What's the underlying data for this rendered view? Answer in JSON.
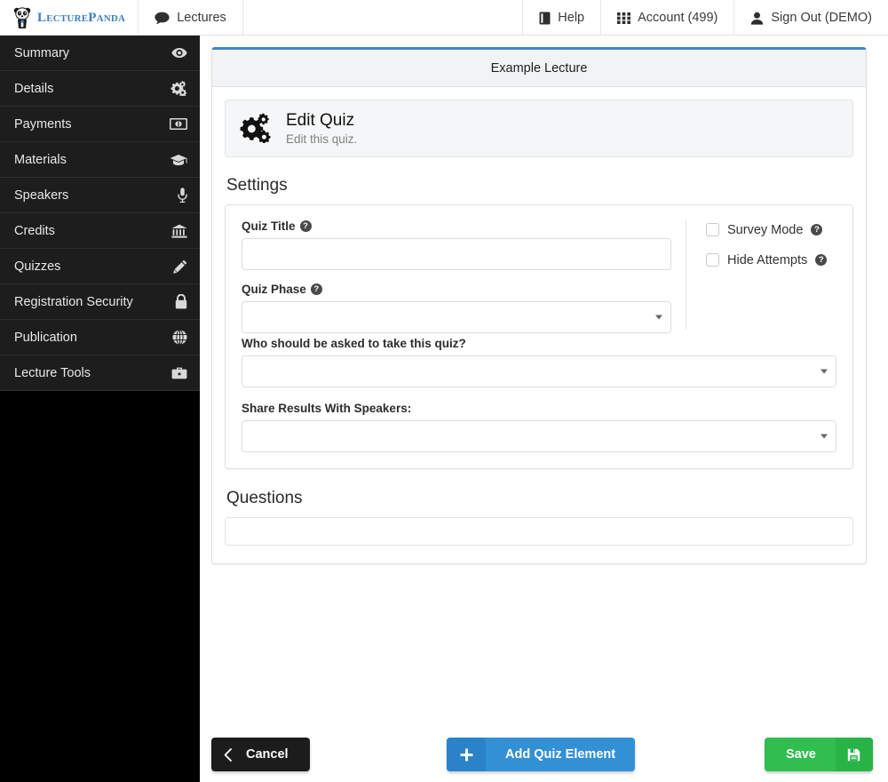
{
  "topnav": {
    "brand": {
      "text": "LecturePanda",
      "icon": "panda-logo-icon"
    },
    "left_items": [
      {
        "label": "Lectures",
        "icon": "comment-icon"
      }
    ],
    "right_items": [
      {
        "label": "Help",
        "icon": "book-icon"
      },
      {
        "label": "Account (499)",
        "icon": "grid-icon"
      },
      {
        "label": "Sign Out (DEMO)",
        "icon": "user-icon"
      }
    ]
  },
  "sidebar": {
    "items": [
      {
        "label": "Summary",
        "icon": "eye-icon"
      },
      {
        "label": "Details",
        "icon": "cogs-icon"
      },
      {
        "label": "Payments",
        "icon": "money-icon"
      },
      {
        "label": "Materials",
        "icon": "graduation-cap-icon"
      },
      {
        "label": "Speakers",
        "icon": "microphone-icon"
      },
      {
        "label": "Credits",
        "icon": "bank-icon"
      },
      {
        "label": "Quizzes",
        "icon": "pencil-icon"
      },
      {
        "label": "Registration Security",
        "icon": "lock-icon"
      },
      {
        "label": "Publication",
        "icon": "globe-icon"
      },
      {
        "label": "Lecture Tools",
        "icon": "briefcase-icon"
      }
    ]
  },
  "panel": {
    "header_title": "Example Lecture",
    "well": {
      "icon": "cogs-icon",
      "title": "Edit Quiz",
      "subtitle": "Edit this quiz."
    },
    "settings": {
      "heading": "Settings",
      "quiz_title": {
        "label": "Quiz Title",
        "help_glyph": "?",
        "value": "",
        "placeholder": ""
      },
      "quiz_phase": {
        "label": "Quiz Phase",
        "help_glyph": "?",
        "selected": "",
        "options": [
          ""
        ]
      },
      "audience": {
        "label": "Who should be asked to take this quiz?",
        "selected": "",
        "options": [
          ""
        ]
      },
      "share_results": {
        "label": "Share Results With Speakers:",
        "selected": "",
        "options": [
          ""
        ]
      },
      "checkboxes": [
        {
          "label": "Survey Mode",
          "checked": false,
          "help_glyph": "?"
        },
        {
          "label": "Hide Attempts",
          "checked": false,
          "help_glyph": "?"
        }
      ]
    },
    "questions": {
      "heading": "Questions",
      "value": "",
      "placeholder": ""
    }
  },
  "footer": {
    "cancel": {
      "label": "Cancel",
      "icon": "chevron-left-icon"
    },
    "add": {
      "label": "Add Quiz Element",
      "icon": "plus-icon",
      "glyph": "+"
    },
    "save": {
      "label": "Save",
      "icon": "floppy-disk-icon"
    }
  },
  "colors": {
    "brand_blue": "#3d7fbd",
    "panel_accent": "#3a87c8",
    "add_button": "#3390d5",
    "save_button": "#2fbe4f",
    "cancel_button": "#1c1c1c",
    "sidebar_item": "#1d1d1d"
  }
}
